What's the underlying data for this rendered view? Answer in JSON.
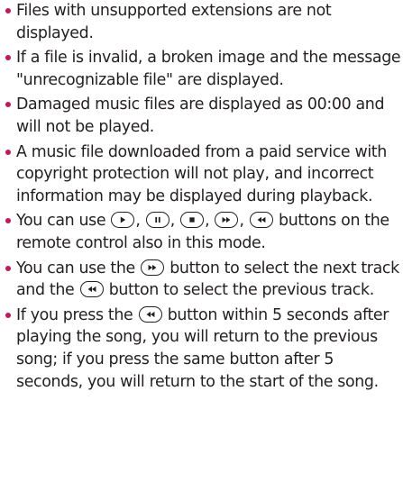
{
  "colors": {
    "bullet": "#c2185b",
    "text": "#231f20"
  },
  "icons": [
    "play-button-icon",
    "pause-button-icon",
    "stop-button-icon",
    "fast-forward-button-icon",
    "rewind-button-icon"
  ],
  "notes": [
    {
      "text": "Files with unsupported extensions are not displayed."
    },
    {
      "text": "If a file is invalid, a broken image and the message \"unrecognizable file\" are displayed."
    },
    {
      "text": "Damaged music files are displayed as 00:00 and will not be played."
    },
    {
      "text": "A music file downloaded from a paid service with copyright protection will not play, and incorrect information may be displayed during playback."
    },
    {
      "pre": "You can use ",
      "sep": ", ",
      "post": " buttons on the remote control also in this mode."
    },
    {
      "pre": "You can use the ",
      "mid": " button to select the next track and the ",
      "post": " button to select the previous track."
    },
    {
      "pre": "If you press the ",
      "post": " button within 5 seconds after playing the song, you will return to the previous song; if you press the same button after 5 seconds, you will return to the start of the song."
    }
  ]
}
